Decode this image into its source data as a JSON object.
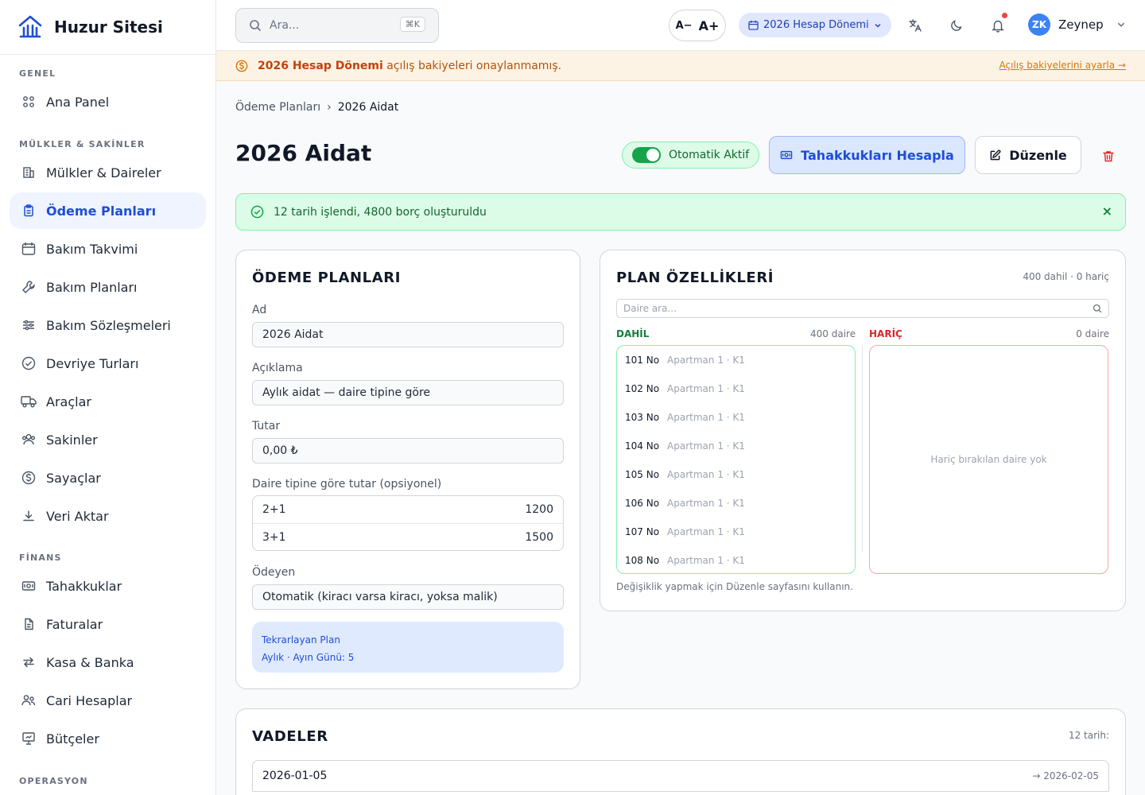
{
  "app": {
    "name": "Huzur Sitesi"
  },
  "sidebar": {
    "sections": [
      {
        "title": "GENEL"
      },
      {
        "title": "MÜLKLER & SAKİNLER"
      },
      {
        "title": "FİNANS"
      },
      {
        "title": "OPERASYON"
      }
    ],
    "items": [
      {
        "label": "Ana Panel",
        "icon": "grid-icon"
      },
      {
        "label": "Mülkler & Daireler",
        "icon": "building-icon"
      },
      {
        "label": "Ödeme Planları",
        "icon": "clipboard-icon",
        "active": true
      },
      {
        "label": "Bakım Takvimi",
        "icon": "calendar-icon"
      },
      {
        "label": "Bakım Planları",
        "icon": "wrench-icon"
      },
      {
        "label": "Bakım Sözleşmeleri",
        "icon": "sliders-icon"
      },
      {
        "label": "Devriye Turları",
        "icon": "check-circle-icon"
      },
      {
        "label": "Araçlar",
        "icon": "truck-icon"
      },
      {
        "label": "Sakinler",
        "icon": "users-icon"
      },
      {
        "label": "Sayaçlar",
        "icon": "dollar-circle-icon"
      },
      {
        "label": "Veri Aktar",
        "icon": "download-icon"
      },
      {
        "label": "Tahakkuklar",
        "icon": "banknote-icon"
      },
      {
        "label": "Faturalar",
        "icon": "file-icon"
      },
      {
        "label": "Kasa & Banka",
        "icon": "arrows-icon"
      },
      {
        "label": "Cari Hesaplar",
        "icon": "users-icon"
      },
      {
        "label": "Bütçeler",
        "icon": "presentation-icon"
      }
    ]
  },
  "topbar": {
    "search_placeholder": "Ara...",
    "search_shortcut": "⌘K",
    "font_decrease": "A−",
    "font_increase": "A+",
    "period": "2026 Hesap Dönemi",
    "user": {
      "initials": "ZK",
      "name": "Zeynep"
    }
  },
  "warning": {
    "strong": "2026 Hesap Dönemi",
    "text": "açılış bakiyeleri onaylanmamış.",
    "link": "Açılış bakiyelerini ayarla →"
  },
  "breadcrumb": {
    "parent": "Ödeme Planları",
    "separator": "›",
    "current": "2026 Aidat"
  },
  "page": {
    "title": "2026 Aidat",
    "toggle_label": "Otomatik Aktif",
    "calc_button": "Tahakkukları Hesapla",
    "edit_button": "Düzenle"
  },
  "success": {
    "message": "12 tarih işlendi, 4800 borç oluşturuldu",
    "close": "×"
  },
  "plan_form": {
    "title": "ÖDEME PLANLARI",
    "name_label": "Ad",
    "name_value": "2026 Aidat",
    "desc_label": "Açıklama",
    "desc_value": "Aylık aidat — daire tipine göre",
    "amount_label": "Tutar",
    "amount_value": "0,00 ₺",
    "type_label": "Daire tipine göre tutar (opsiyonel)",
    "type_rows": [
      {
        "type": "2+1",
        "amount": "1200"
      },
      {
        "type": "3+1",
        "amount": "1500"
      }
    ],
    "payer_label": "Ödeyen",
    "payer_value": "Otomatik (kiracı varsa kiracı, yoksa malik)",
    "recurring_title": "Tekrarlayan Plan",
    "recurring_detail": "Aylık · Ayın Günü: 5"
  },
  "plan_features": {
    "title": "PLAN ÖZELLİKLERİ",
    "summary": "400 dahil · 0 hariç",
    "search_placeholder": "Daire ara...",
    "included_title": "DAHİL",
    "included_count": "400 daire",
    "excluded_title": "HARİÇ",
    "excluded_count": "0 daire",
    "excluded_empty": "Hariç bırakılan daire yok",
    "note": "Değişiklik yapmak için Düzenle sayfasını kullanın.",
    "apartments": [
      {
        "no": "101 No",
        "loc": "Apartman 1 · K1"
      },
      {
        "no": "102 No",
        "loc": "Apartman 1 · K1"
      },
      {
        "no": "103 No",
        "loc": "Apartman 1 · K1"
      },
      {
        "no": "104 No",
        "loc": "Apartman 1 · K1"
      },
      {
        "no": "105 No",
        "loc": "Apartman 1 · K1"
      },
      {
        "no": "106 No",
        "loc": "Apartman 1 · K1"
      },
      {
        "no": "107 No",
        "loc": "Apartman 1 · K1"
      },
      {
        "no": "108 No",
        "loc": "Apartman 1 · K1"
      }
    ]
  },
  "due_dates": {
    "title": "VADELER",
    "summary": "12 tarih:",
    "rows": [
      {
        "date": "2026-01-05",
        "due": "→ 2026-02-05"
      }
    ]
  }
}
